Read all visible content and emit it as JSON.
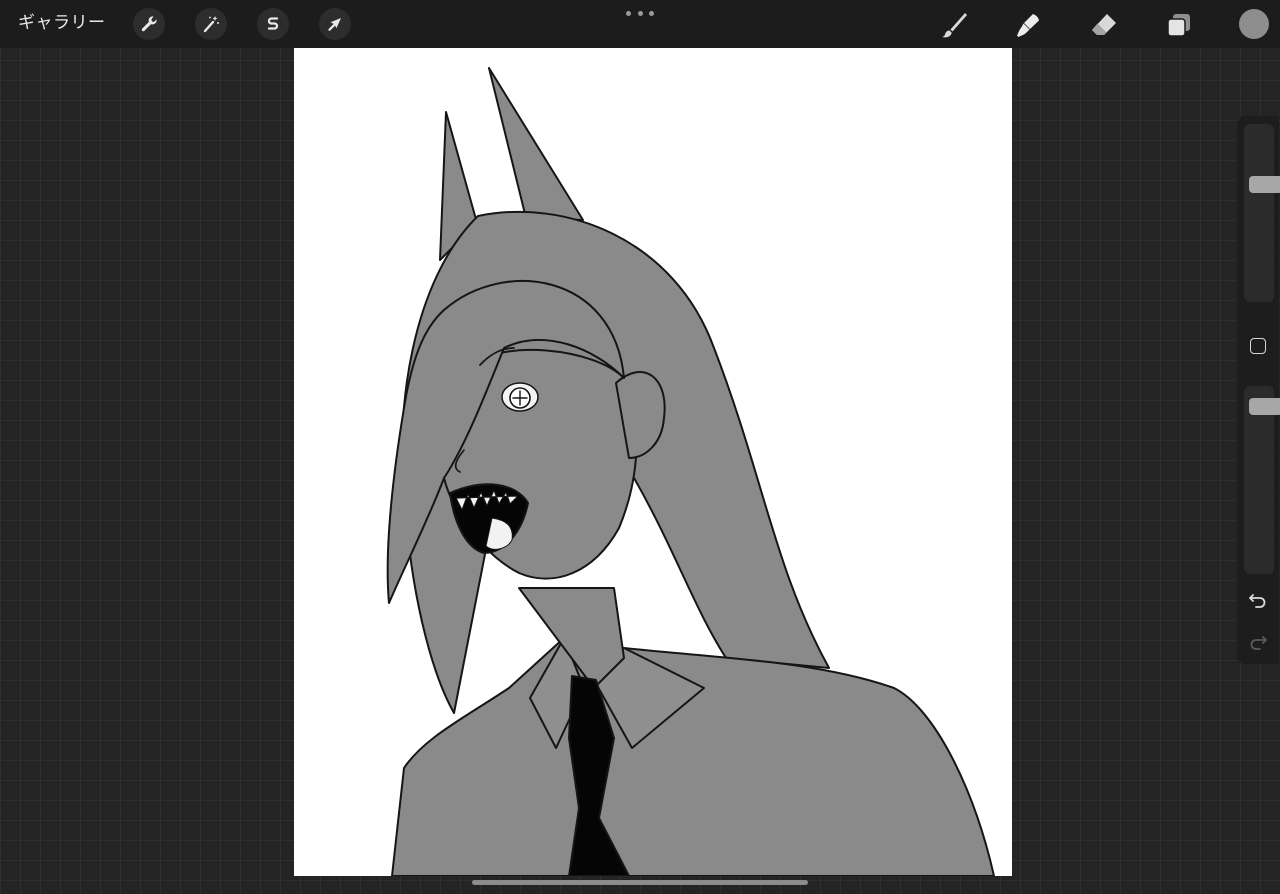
{
  "topbar": {
    "gallery_label": "ギャラリー",
    "left_tools": [
      {
        "name": "actions",
        "icon": "wrench-icon"
      },
      {
        "name": "adjustments",
        "icon": "magic-wand-icon"
      },
      {
        "name": "selection",
        "icon": "selection-s-icon"
      },
      {
        "name": "transform",
        "icon": "arrow-cursor-icon"
      }
    ],
    "more_icon": "ellipsis-icon",
    "right_tools": [
      {
        "name": "brush",
        "icon": "brush-icon"
      },
      {
        "name": "smudge",
        "icon": "smudge-icon"
      },
      {
        "name": "eraser",
        "icon": "eraser-icon"
      },
      {
        "name": "layers",
        "icon": "layers-icon"
      }
    ],
    "current_color": "#8e8e8e"
  },
  "sidebar": {
    "brush_size": 0.68,
    "brush_opacity": 0.93,
    "modify_icon": "square-icon",
    "undo_icon": "undo-icon",
    "redo_icon": "redo-icon"
  },
  "canvas": {
    "background": "#ffffff",
    "artwork": "illustration-grayscale"
  },
  "colors": {
    "ui_dark": "#1c1c1c",
    "canvas_fill_gray": "#8a8a8a",
    "line": "#111111"
  }
}
